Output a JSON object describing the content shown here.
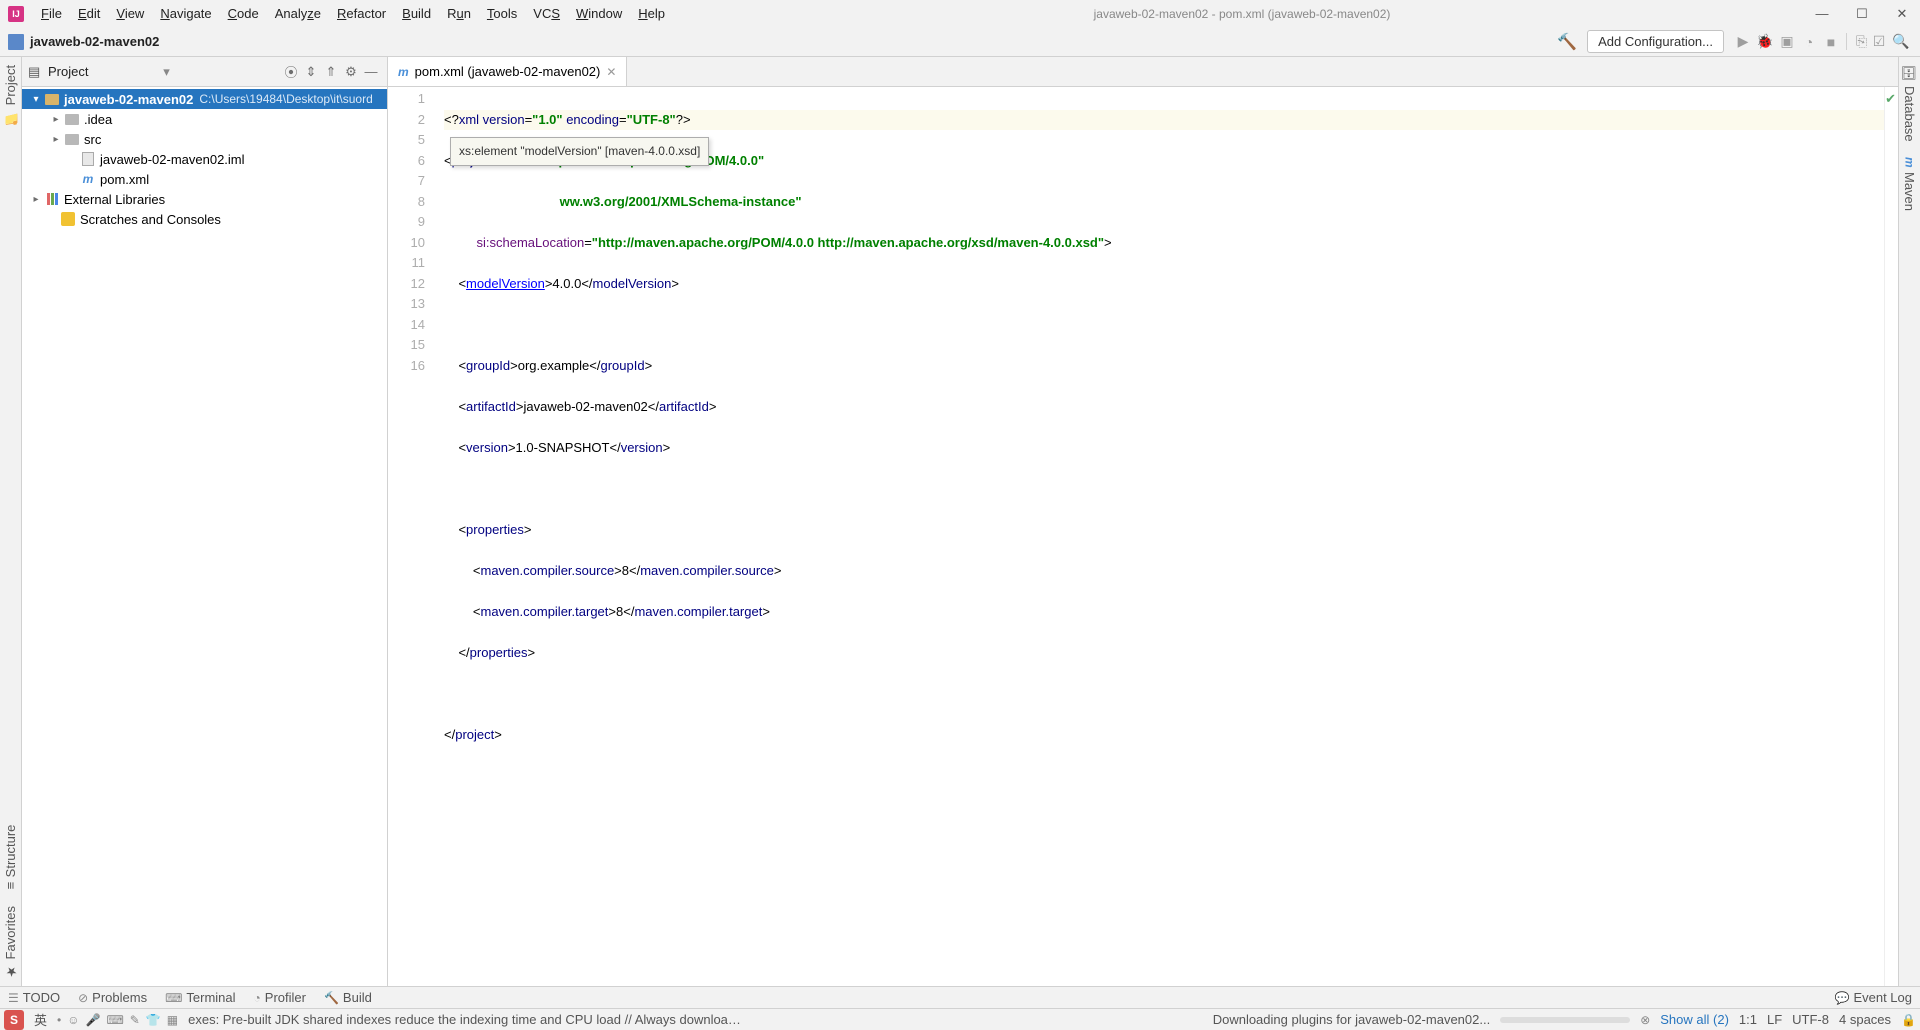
{
  "title": "javaweb-02-maven02 - pom.xml (javaweb-02-maven02)",
  "menus": [
    "File",
    "Edit",
    "View",
    "Navigate",
    "Code",
    "Analyze",
    "Refactor",
    "Build",
    "Run",
    "Tools",
    "VCS",
    "Window",
    "Help"
  ],
  "breadcrumb": "javaweb-02-maven02",
  "run_config": "Add Configuration...",
  "project_panel_title": "Project",
  "tree": {
    "root": {
      "name": "javaweb-02-maven02",
      "path": "C:\\Users\\19484\\Desktop\\it\\suord"
    },
    "idea": ".idea",
    "src": "src",
    "iml": "javaweb-02-maven02.iml",
    "pom": "pom.xml",
    "ext": "External Libraries",
    "scratch": "Scratches and Consoles"
  },
  "tab_label": "pom.xml (javaweb-02-maven02)",
  "tooltip": "xs:element \"modelVersion\" [maven-4.0.0.xsd]",
  "gutter_lines": [
    "1",
    "2",
    "",
    "",
    "5",
    "6",
    "7",
    "8",
    "9",
    "10",
    "11",
    "12",
    "13",
    "14",
    "15",
    "16"
  ],
  "code": {
    "l1_a": "<?",
    "l1_b": "xml version",
    "l1_c": "=",
    "l1_d": "\"1.0\"",
    "l1_e": " encoding",
    "l1_f": "=",
    "l1_g": "\"UTF-8\"",
    "l1_h": "?>",
    "l2_a": "<",
    "l2_b": "project",
    "l2_c": " xmlns",
    "l2_d": "=",
    "l2_e": "\"http://maven.apache.org/POM/4.0.0\"",
    "l3_a": "ww.w3.org/2001/XMLSchema-instance\"",
    "l4_a": "si:schemaLocation",
    "l4_b": "=",
    "l4_c": "\"http://maven.apache.org/POM/4.0.0 http://maven.apache.org/xsd/maven-4.0.0.xsd\"",
    "l4_d": ">",
    "l5_a": "    <",
    "l5_b": "modelVersion",
    "l5_c": ">4.0.0</",
    "l5_d": "modelVersion",
    "l5_e": ">",
    "l7_a": "    <",
    "l7_b": "groupId",
    "l7_c": ">org.example</",
    "l7_d": "groupId",
    "l7_e": ">",
    "l8_a": "    <",
    "l8_b": "artifactId",
    "l8_c": ">javaweb-02-maven02</",
    "l8_d": "artifactId",
    "l8_e": ">",
    "l9_a": "    <",
    "l9_b": "version",
    "l9_c": ">1.0-SNAPSHOT</",
    "l9_d": "version",
    "l9_e": ">",
    "l11_a": "    <",
    "l11_b": "properties",
    "l11_c": ">",
    "l12_a": "        <",
    "l12_b": "maven.compiler.source",
    "l12_c": ">8</",
    "l12_d": "maven.compiler.source",
    "l12_e": ">",
    "l13_a": "        <",
    "l13_b": "maven.compiler.target",
    "l13_c": ">8</",
    "l13_d": "maven.compiler.target",
    "l13_e": ">",
    "l14_a": "    </",
    "l14_b": "properties",
    "l14_c": ">",
    "l16_a": "</",
    "l16_b": "project",
    "l16_c": ">"
  },
  "rails": {
    "project": "Project",
    "structure": "Structure",
    "favorites": "Favorites",
    "database": "Database",
    "maven": "Maven"
  },
  "bottom_tools": {
    "todo": "TODO",
    "problems": "Problems",
    "terminal": "Terminal",
    "profiler": "Profiler",
    "build": "Build",
    "eventlog": "Event Log"
  },
  "status": {
    "ime": "S",
    "lang": "英",
    "indexes": "exes: Pre-built JDK shared indexes reduce the indexing time and CPU load // Always download // Dov",
    "downloading": "Downloading plugins for javaweb-02-maven02...",
    "showall": "Show all (2)",
    "pos": "1:1",
    "le": "LF",
    "enc": "UTF-8",
    "indent": "4 spaces"
  }
}
